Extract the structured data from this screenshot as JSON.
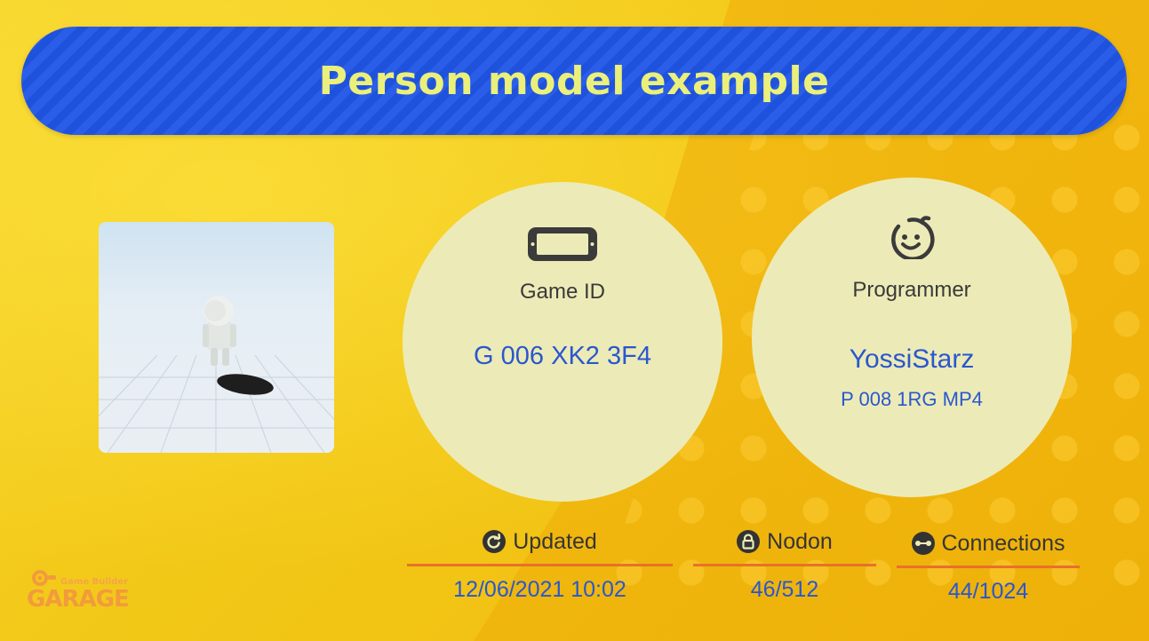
{
  "title": "Person model example",
  "game_id": {
    "label": "Game ID",
    "value": "G 006 XK2 3F4",
    "icon": "console-icon"
  },
  "programmer": {
    "label": "Programmer",
    "name": "YossiStarz",
    "id": "P 008 1RG MP4",
    "icon": "face-icon"
  },
  "stats": {
    "updated": {
      "label": "Updated",
      "value": "12/06/2021 10:02",
      "icon": "refresh-icon"
    },
    "nodon": {
      "label": "Nodon",
      "value": "46/512",
      "icon": "lock-icon"
    },
    "connections": {
      "label": "Connections",
      "value": "44/1024",
      "icon": "connection-icon"
    }
  },
  "logo": {
    "small": "Game Builder",
    "big": "GARAGE"
  },
  "colors": {
    "background": "#f3c71a",
    "title_bar": "#2a5ee8",
    "title_text": "#eaf07a",
    "circle": "#ecebb7",
    "value_text": "#2a57cf",
    "underline": "#e8702a"
  }
}
